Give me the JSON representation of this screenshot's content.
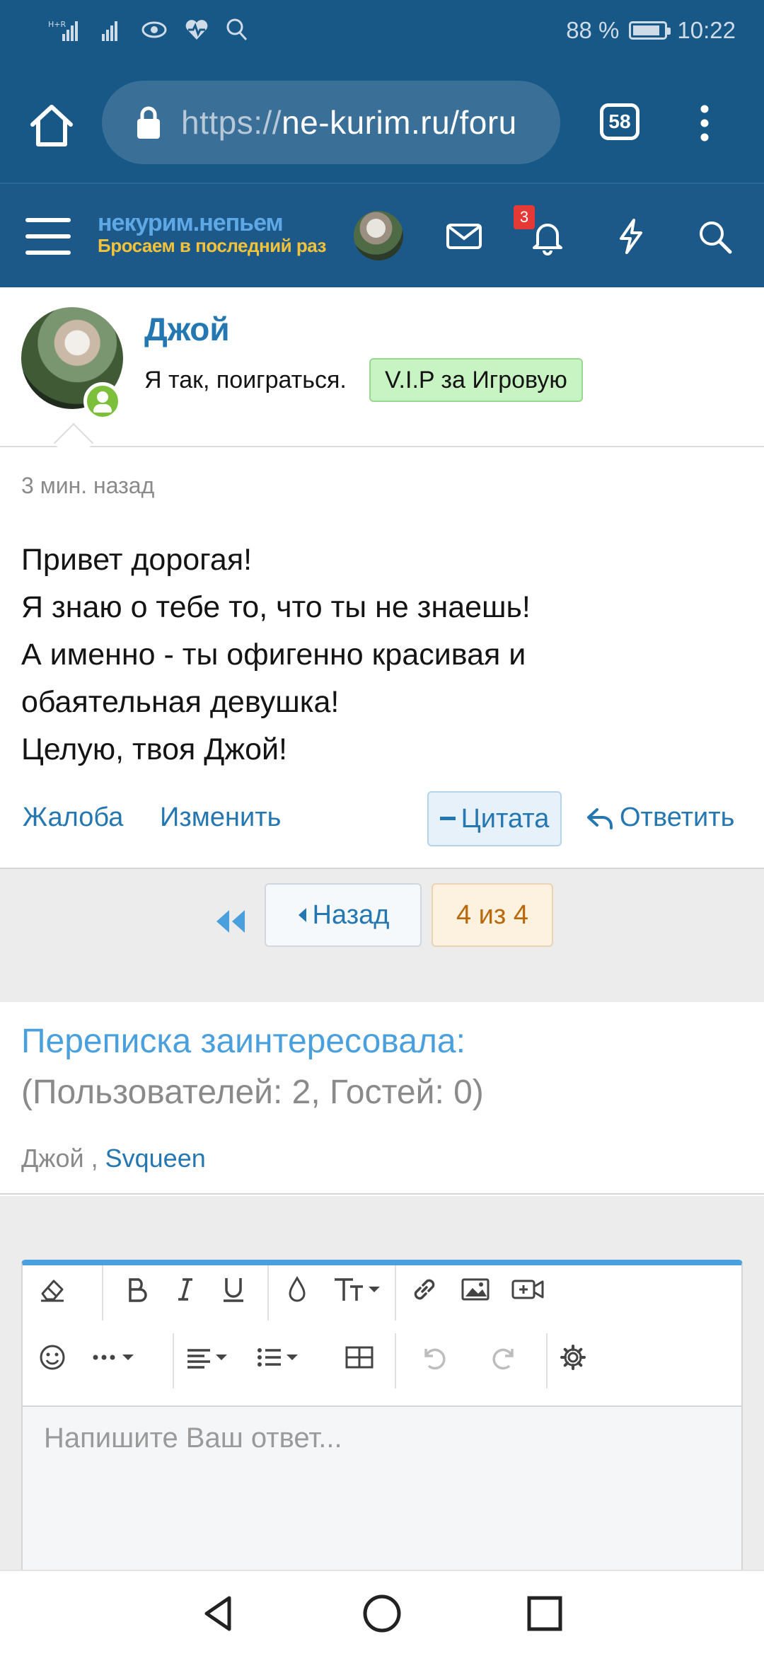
{
  "status_bar": {
    "battery": "88 %",
    "battery_level": 0.88,
    "time": "10:22"
  },
  "browser": {
    "url_scheme": "https://",
    "url_host": "ne-kurim.ru/foru",
    "tab_count": "58"
  },
  "site_header": {
    "logo_top": "некурим.непьем",
    "logo_bottom": "Бросаем в последний раз",
    "notification_count": "3"
  },
  "post": {
    "author": "Джой",
    "user_title": "Я так, поиграться.",
    "user_badge": "V.I.P за Игровую",
    "time": "3 мин. назад",
    "body_lines": [
      "Привет дорогая!",
      "Я знаю о тебе то, что ты не знаешь!",
      "А именно - ты офигенно красивая и",
      "обаятельная девушка!",
      "Целую, твоя Джой!"
    ],
    "actions": {
      "report": "Жалоба",
      "edit": "Изменить",
      "quote": "Цитата",
      "reply": "Ответить"
    }
  },
  "pagination": {
    "back": "Назад",
    "current": "4 из 4"
  },
  "watchers": {
    "title": "Переписка заинтересовала:",
    "count": "(Пользователей: 2, Гостей: 0)",
    "user_1": "Джой",
    "separator": " ,",
    "user_2": "Svqueen"
  },
  "editor": {
    "placeholder": "Напишите Ваш ответ..."
  },
  "colors": {
    "header_bg": "#185886",
    "link": "#2577b1",
    "accent": "#4aa0dc",
    "online": "#7bbf3a",
    "badge": "#e53935"
  }
}
